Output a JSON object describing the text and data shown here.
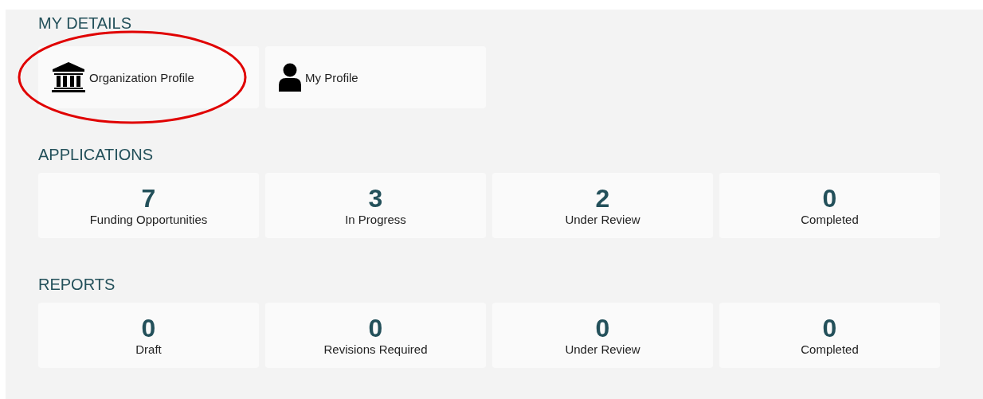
{
  "my_details": {
    "heading": "MY DETAILS",
    "items": [
      {
        "label": "Organization Profile",
        "kind": "organization"
      },
      {
        "label": "My Profile",
        "kind": "person"
      }
    ]
  },
  "applications": {
    "heading": "APPLICATIONS",
    "stats": [
      {
        "count": "7",
        "label": "Funding Opportunities"
      },
      {
        "count": "3",
        "label": "In Progress"
      },
      {
        "count": "2",
        "label": "Under Review"
      },
      {
        "count": "0",
        "label": "Completed"
      }
    ]
  },
  "reports": {
    "heading": "REPORTS",
    "stats": [
      {
        "count": "0",
        "label": "Draft"
      },
      {
        "count": "0",
        "label": "Revisions Required"
      },
      {
        "count": "0",
        "label": "Under Review"
      },
      {
        "count": "0",
        "label": "Completed"
      }
    ]
  }
}
